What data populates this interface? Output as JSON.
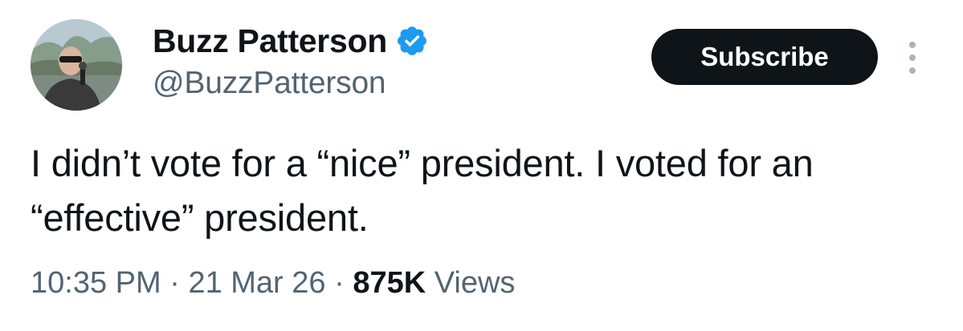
{
  "author": {
    "display_name": "Buzz Patterson",
    "handle": "@BuzzPatterson",
    "verified": true,
    "verified_color": "#1d9bf0"
  },
  "actions": {
    "subscribe_label": "Subscribe",
    "more_icon": "more-vertical-icon"
  },
  "tweet": {
    "text": "I didn’t vote for a “nice” president. I voted for an “effective” president."
  },
  "meta": {
    "time": "10:35 PM",
    "separator": "·",
    "date": "21 Mar 26",
    "views_count": "875K",
    "views_label": "Views"
  },
  "colors": {
    "text_primary": "#0f1419",
    "text_secondary": "#536471",
    "button_bg": "#0f1419",
    "button_text": "#ffffff"
  }
}
